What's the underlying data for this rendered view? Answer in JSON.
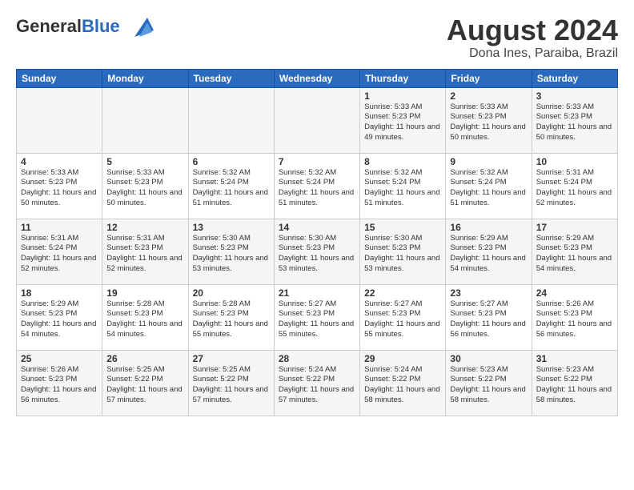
{
  "header": {
    "logo_line1": "General",
    "logo_line2": "Blue",
    "month": "August 2024",
    "location": "Dona Ines, Paraiba, Brazil"
  },
  "weekdays": [
    "Sunday",
    "Monday",
    "Tuesday",
    "Wednesday",
    "Thursday",
    "Friday",
    "Saturday"
  ],
  "weeks": [
    [
      {
        "day": "",
        "info": ""
      },
      {
        "day": "",
        "info": ""
      },
      {
        "day": "",
        "info": ""
      },
      {
        "day": "",
        "info": ""
      },
      {
        "day": "1",
        "info": "Sunrise: 5:33 AM\nSunset: 5:23 PM\nDaylight: 11 hours\nand 49 minutes."
      },
      {
        "day": "2",
        "info": "Sunrise: 5:33 AM\nSunset: 5:23 PM\nDaylight: 11 hours\nand 50 minutes."
      },
      {
        "day": "3",
        "info": "Sunrise: 5:33 AM\nSunset: 5:23 PM\nDaylight: 11 hours\nand 50 minutes."
      }
    ],
    [
      {
        "day": "4",
        "info": "Sunrise: 5:33 AM\nSunset: 5:23 PM\nDaylight: 11 hours\nand 50 minutes."
      },
      {
        "day": "5",
        "info": "Sunrise: 5:33 AM\nSunset: 5:23 PM\nDaylight: 11 hours\nand 50 minutes."
      },
      {
        "day": "6",
        "info": "Sunrise: 5:32 AM\nSunset: 5:24 PM\nDaylight: 11 hours\nand 51 minutes."
      },
      {
        "day": "7",
        "info": "Sunrise: 5:32 AM\nSunset: 5:24 PM\nDaylight: 11 hours\nand 51 minutes."
      },
      {
        "day": "8",
        "info": "Sunrise: 5:32 AM\nSunset: 5:24 PM\nDaylight: 11 hours\nand 51 minutes."
      },
      {
        "day": "9",
        "info": "Sunrise: 5:32 AM\nSunset: 5:24 PM\nDaylight: 11 hours\nand 51 minutes."
      },
      {
        "day": "10",
        "info": "Sunrise: 5:31 AM\nSunset: 5:24 PM\nDaylight: 11 hours\nand 52 minutes."
      }
    ],
    [
      {
        "day": "11",
        "info": "Sunrise: 5:31 AM\nSunset: 5:24 PM\nDaylight: 11 hours\nand 52 minutes."
      },
      {
        "day": "12",
        "info": "Sunrise: 5:31 AM\nSunset: 5:23 PM\nDaylight: 11 hours\nand 52 minutes."
      },
      {
        "day": "13",
        "info": "Sunrise: 5:30 AM\nSunset: 5:23 PM\nDaylight: 11 hours\nand 53 minutes."
      },
      {
        "day": "14",
        "info": "Sunrise: 5:30 AM\nSunset: 5:23 PM\nDaylight: 11 hours\nand 53 minutes."
      },
      {
        "day": "15",
        "info": "Sunrise: 5:30 AM\nSunset: 5:23 PM\nDaylight: 11 hours\nand 53 minutes."
      },
      {
        "day": "16",
        "info": "Sunrise: 5:29 AM\nSunset: 5:23 PM\nDaylight: 11 hours\nand 54 minutes."
      },
      {
        "day": "17",
        "info": "Sunrise: 5:29 AM\nSunset: 5:23 PM\nDaylight: 11 hours\nand 54 minutes."
      }
    ],
    [
      {
        "day": "18",
        "info": "Sunrise: 5:29 AM\nSunset: 5:23 PM\nDaylight: 11 hours\nand 54 minutes."
      },
      {
        "day": "19",
        "info": "Sunrise: 5:28 AM\nSunset: 5:23 PM\nDaylight: 11 hours\nand 54 minutes."
      },
      {
        "day": "20",
        "info": "Sunrise: 5:28 AM\nSunset: 5:23 PM\nDaylight: 11 hours\nand 55 minutes."
      },
      {
        "day": "21",
        "info": "Sunrise: 5:27 AM\nSunset: 5:23 PM\nDaylight: 11 hours\nand 55 minutes."
      },
      {
        "day": "22",
        "info": "Sunrise: 5:27 AM\nSunset: 5:23 PM\nDaylight: 11 hours\nand 55 minutes."
      },
      {
        "day": "23",
        "info": "Sunrise: 5:27 AM\nSunset: 5:23 PM\nDaylight: 11 hours\nand 56 minutes."
      },
      {
        "day": "24",
        "info": "Sunrise: 5:26 AM\nSunset: 5:23 PM\nDaylight: 11 hours\nand 56 minutes."
      }
    ],
    [
      {
        "day": "25",
        "info": "Sunrise: 5:26 AM\nSunset: 5:23 PM\nDaylight: 11 hours\nand 56 minutes."
      },
      {
        "day": "26",
        "info": "Sunrise: 5:25 AM\nSunset: 5:22 PM\nDaylight: 11 hours\nand 57 minutes."
      },
      {
        "day": "27",
        "info": "Sunrise: 5:25 AM\nSunset: 5:22 PM\nDaylight: 11 hours\nand 57 minutes."
      },
      {
        "day": "28",
        "info": "Sunrise: 5:24 AM\nSunset: 5:22 PM\nDaylight: 11 hours\nand 57 minutes."
      },
      {
        "day": "29",
        "info": "Sunrise: 5:24 AM\nSunset: 5:22 PM\nDaylight: 11 hours\nand 58 minutes."
      },
      {
        "day": "30",
        "info": "Sunrise: 5:23 AM\nSunset: 5:22 PM\nDaylight: 11 hours\nand 58 minutes."
      },
      {
        "day": "31",
        "info": "Sunrise: 5:23 AM\nSunset: 5:22 PM\nDaylight: 11 hours\nand 58 minutes."
      }
    ]
  ]
}
